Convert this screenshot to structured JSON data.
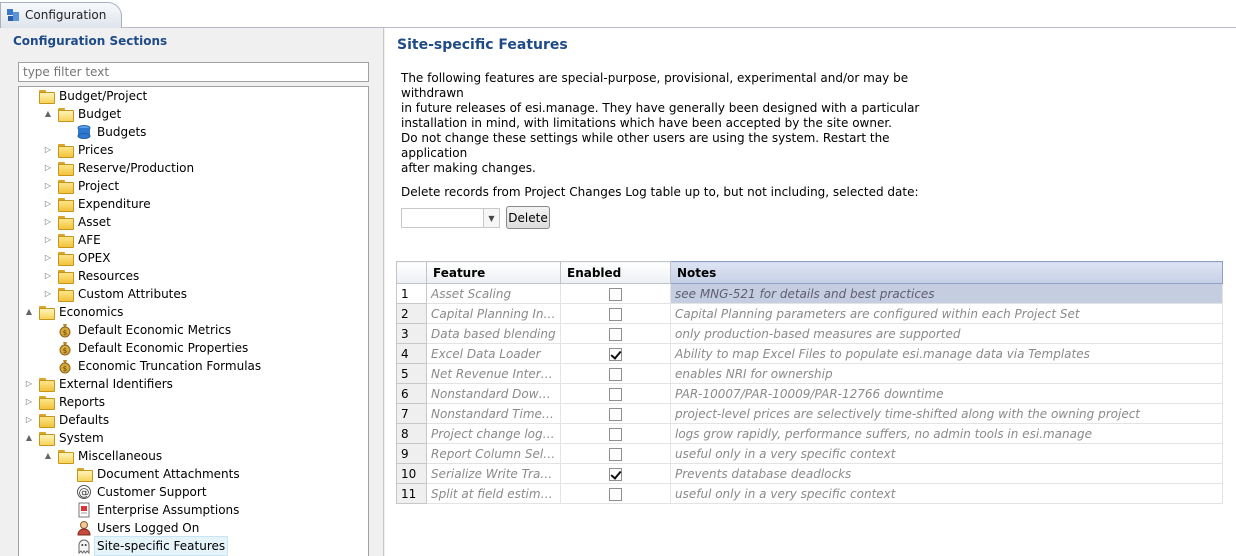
{
  "tab": {
    "label": "Configuration"
  },
  "sidebar": {
    "title": "Configuration Sections",
    "filter_placeholder": "type filter text",
    "tree": [
      {
        "label": "Budget/Project",
        "level": 0,
        "icon": "folder-open-icon",
        "toggle": "",
        "expanded": true
      },
      {
        "label": "Budget",
        "level": 1,
        "icon": "folder-open-icon",
        "toggle": "▲",
        "expanded": true
      },
      {
        "label": "Budgets",
        "level": 2,
        "icon": "database-icon",
        "toggle": ""
      },
      {
        "label": "Prices",
        "level": 1,
        "icon": "folder-icon",
        "toggle": "▷"
      },
      {
        "label": "Reserve/Production",
        "level": 1,
        "icon": "folder-icon",
        "toggle": "▷"
      },
      {
        "label": "Project",
        "level": 1,
        "icon": "folder-icon",
        "toggle": "▷"
      },
      {
        "label": "Expenditure",
        "level": 1,
        "icon": "folder-icon",
        "toggle": "▷"
      },
      {
        "label": "Asset",
        "level": 1,
        "icon": "folder-icon",
        "toggle": "▷"
      },
      {
        "label": "AFE",
        "level": 1,
        "icon": "folder-icon",
        "toggle": "▷"
      },
      {
        "label": "OPEX",
        "level": 1,
        "icon": "folder-icon",
        "toggle": "▷"
      },
      {
        "label": "Resources",
        "level": 1,
        "icon": "folder-icon",
        "toggle": "▷"
      },
      {
        "label": "Custom Attributes",
        "level": 1,
        "icon": "folder-icon",
        "toggle": "▷"
      },
      {
        "label": "Economics",
        "level": 0,
        "icon": "folder-open-icon",
        "toggle": "▲",
        "expanded": true
      },
      {
        "label": "Default Economic Metrics",
        "level": 1,
        "icon": "money-bag-icon",
        "toggle": ""
      },
      {
        "label": "Default Economic Properties",
        "level": 1,
        "icon": "money-bag-icon",
        "toggle": ""
      },
      {
        "label": "Economic Truncation Formulas",
        "level": 1,
        "icon": "money-bag-icon",
        "toggle": ""
      },
      {
        "label": "External Identifiers",
        "level": 0,
        "icon": "folder-icon",
        "toggle": "▷"
      },
      {
        "label": "Reports",
        "level": 0,
        "icon": "folder-icon",
        "toggle": "▷"
      },
      {
        "label": "Defaults",
        "level": 0,
        "icon": "folder-icon",
        "toggle": "▷"
      },
      {
        "label": "System",
        "level": 0,
        "icon": "folder-open-icon",
        "toggle": "▲",
        "expanded": true
      },
      {
        "label": "Miscellaneous",
        "level": 1,
        "icon": "folder-open-icon",
        "toggle": "▲",
        "expanded": true
      },
      {
        "label": "Document Attachments",
        "level": 2,
        "icon": "folder-attachment-icon",
        "toggle": ""
      },
      {
        "label": "Customer Support",
        "level": 2,
        "icon": "at-sign-icon",
        "toggle": ""
      },
      {
        "label": "Enterprise Assumptions",
        "level": 2,
        "icon": "document-icon",
        "toggle": ""
      },
      {
        "label": "Users Logged On",
        "level": 2,
        "icon": "user-icon",
        "toggle": ""
      },
      {
        "label": "Site-specific Features",
        "level": 2,
        "icon": "ghost-icon",
        "toggle": "",
        "selected": true
      }
    ]
  },
  "main": {
    "title": "Site-specific Features",
    "paragraph1": "The following features are special-purpose, provisional, experimental and/or may be withdrawn\nin future releases of esi.manage.  They have generally been designed with a particular\ninstallation in mind, with limitations which have been accepted by the site owner.",
    "paragraph2": "Do not change these settings while other users are using the system.  Restart the application\nafter making changes.",
    "delete_label": "Delete records from Project Changes Log table up to, but not including, selected date:",
    "date_value": "",
    "delete_button": "Delete",
    "grid": {
      "headers": {
        "feature": "Feature",
        "enabled": "Enabled",
        "notes": "Notes"
      },
      "rows": [
        {
          "num": "1",
          "feature": "Asset Scaling",
          "enabled": false,
          "notes": "see MNG-521 for details and best practices",
          "selected": true
        },
        {
          "num": "2",
          "feature": "Capital Planning Inte...",
          "enabled": false,
          "notes": "Capital Planning parameters are configured within each Project Set"
        },
        {
          "num": "3",
          "feature": "Data based blending",
          "enabled": false,
          "notes": "only production-based measures are supported"
        },
        {
          "num": "4",
          "feature": "Excel Data Loader",
          "enabled": true,
          "notes": "Ability to map Excel Files to populate esi.manage data via Templates"
        },
        {
          "num": "5",
          "feature": "Net Revenue Interest",
          "enabled": false,
          "notes": "enables NRI for ownership"
        },
        {
          "num": "6",
          "feature": "Nonstandard Downti...",
          "enabled": false,
          "notes": "PAR-10007/PAR-10009/PAR-12766 downtime"
        },
        {
          "num": "7",
          "feature": "Nonstandard Time-S...",
          "enabled": false,
          "notes": "project-level prices are selectively time-shifted along with the owning project"
        },
        {
          "num": "8",
          "feature": "Project change logging",
          "enabled": false,
          "notes": "logs grow rapidly, performance suffers, no admin tools in esi.manage"
        },
        {
          "num": "9",
          "feature": "Report Column Selecti...",
          "enabled": false,
          "notes": "useful only in a very specific context"
        },
        {
          "num": "10",
          "feature": "Serialize Write Transa...",
          "enabled": true,
          "notes": "Prevents database deadlocks"
        },
        {
          "num": "11",
          "feature": "Split at field estimate",
          "enabled": false,
          "notes": "useful only in a very specific context"
        }
      ]
    }
  },
  "colors": {
    "title_blue": "#1e4b87",
    "selected_notes": "#c5cde0"
  }
}
